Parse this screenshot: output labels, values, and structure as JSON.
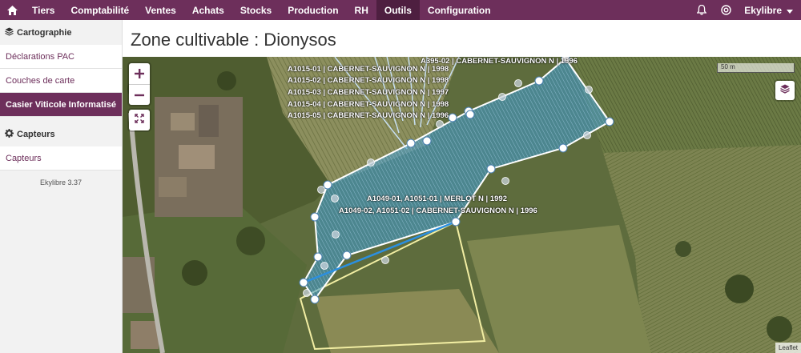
{
  "nav": {
    "items": [
      "Tiers",
      "Comptabilité",
      "Ventes",
      "Achats",
      "Stocks",
      "Production",
      "RH",
      "Outils",
      "Configuration"
    ],
    "active": "Outils",
    "user": "Ekylibre",
    "icons": [
      "home-icon",
      "bell-icon",
      "globe-icon",
      "caret-down-icon"
    ]
  },
  "sidebar": {
    "cartographie": {
      "title": "Cartographie",
      "items": [
        "Déclarations PAC",
        "Couches de carte",
        "Casier Viticole Informatisé"
      ]
    },
    "capteurs": {
      "title": "Capteurs",
      "items": [
        "Capteurs"
      ]
    },
    "version": "Ekylibre 3.37"
  },
  "page": {
    "title": "Zone cultivable : Dionysos"
  },
  "map": {
    "scale_label": "50 m",
    "attribution": "Leaflet",
    "labels": [
      "A395-02 | CABERNET-SAUVIGNON N | 1996",
      "A1015-01 | CABERNET-SAUVIGNON N | 1998",
      "A1015-02 | CABERNET-SAUVIGNON N | 1998",
      "A1015-03 | CABERNET-SAUVIGNON N | 1997",
      "A1015-04 | CABERNET-SAUVIGNON N | 1998",
      "A1015-05 | CABERNET-SAUVIGNON N | 1996",
      "A1049-01, A1051-01 | MERLOT N | 1992",
      "A1049-02, A1051-02 | CABERNET-SAUVIGNON N | 1996"
    ],
    "colors": {
      "zone_fill": "#3d9ad1",
      "zone_stroke": "#ffffff",
      "parcel_outline": "#f2eea3",
      "accent": "#6d2f5b"
    }
  }
}
